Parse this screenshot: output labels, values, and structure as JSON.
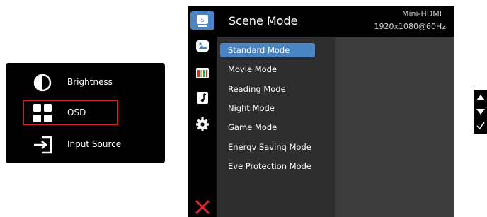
{
  "quick_menu": {
    "items": [
      {
        "label": "Brightness",
        "icon": "brightness-icon"
      },
      {
        "label": "OSD",
        "icon": "osd-grid-icon",
        "selected": true
      },
      {
        "label": "Input Source",
        "icon": "input-source-icon"
      }
    ],
    "selection_color": "#d62028"
  },
  "osd": {
    "title": "Scene Mode",
    "source": "Mini-HDMI",
    "signal": "1920x1080@60Hz",
    "accent": "#4a86c6",
    "sidebar": [
      {
        "icon": "scene-mode-icon",
        "label": "S",
        "active": true
      },
      {
        "icon": "picture-icon"
      },
      {
        "icon": "color-bars-icon"
      },
      {
        "icon": "music-note-icon"
      },
      {
        "icon": "gear-icon"
      }
    ],
    "menu_items": [
      {
        "label": "Standard Mode",
        "active": true
      },
      {
        "label": "Movie Mode"
      },
      {
        "label": "Reading Mode"
      },
      {
        "label": "Night Mode"
      },
      {
        "label": "Game Mode"
      },
      {
        "label": "Enerqv Savinq Mode"
      },
      {
        "label": "Eve Protection Mode"
      }
    ],
    "exit_icon": "close-icon",
    "exit_color": "#e0282e"
  },
  "nav_keys": [
    "up-arrow-icon",
    "down-arrow-icon",
    "check-icon"
  ]
}
